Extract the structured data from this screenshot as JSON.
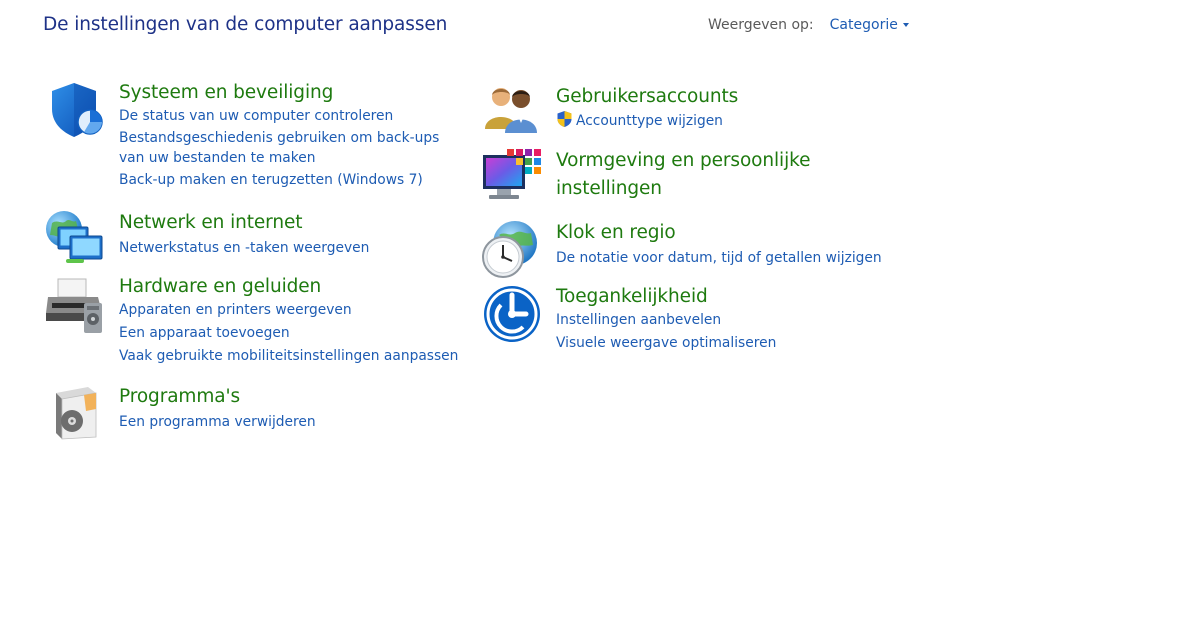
{
  "header": {
    "title": "De instellingen van de computer aanpassen",
    "view_by_label": "Weergeven op:",
    "view_by_value": "Categorie"
  },
  "categories": [
    {
      "icon": "security-shield-icon",
      "title": "Systeem en beveiliging",
      "links": [
        "De status van uw computer controleren",
        "Bestandsgeschiedenis gebruiken om back-ups van uw bestanden te maken",
        "Back-up maken en terugzetten (Windows 7)"
      ]
    },
    {
      "icon": "network-globe-icon",
      "title": "Netwerk en internet",
      "links": [
        "Netwerkstatus en -taken weergeven"
      ]
    },
    {
      "icon": "printer-icon",
      "title": "Hardware en geluiden",
      "links": [
        "Apparaten en printers weergeven",
        "Een apparaat toevoegen",
        "Vaak gebruikte mobiliteitsinstellingen aanpassen"
      ]
    },
    {
      "icon": "programs-box-icon",
      "title": "Programma's",
      "links": [
        "Een programma verwijderen"
      ]
    },
    {
      "icon": "user-accounts-icon",
      "title": "Gebruikersaccounts",
      "links": [
        "Accounttype wijzigen"
      ]
    },
    {
      "icon": "appearance-monitor-icon",
      "title": "Vormgeving en persoonlijke instellingen",
      "links": []
    },
    {
      "icon": "clock-globe-icon",
      "title": "Klok en regio",
      "links": [
        "De notatie voor datum, tijd of getallen wijzigen"
      ]
    },
    {
      "icon": "accessibility-icon",
      "title": "Toegankelijkheid",
      "links": [
        "Instellingen aanbevelen",
        "Visuele weergave optimaliseren"
      ]
    }
  ]
}
